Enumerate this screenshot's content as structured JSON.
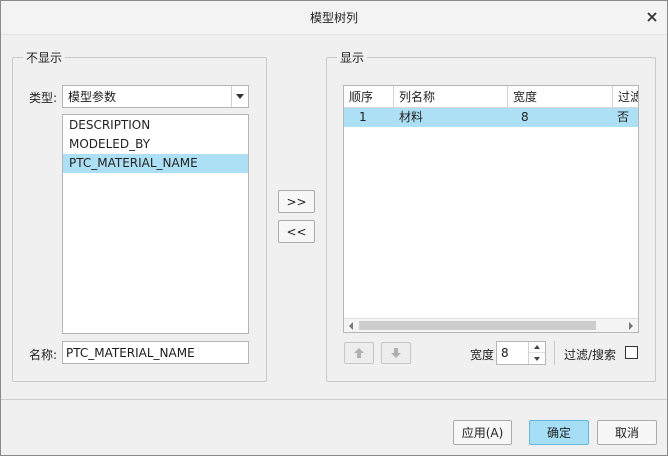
{
  "window": {
    "title": "模型树列"
  },
  "left_panel": {
    "legend": "不显示",
    "type_label": "类型:",
    "type_value": "模型参数",
    "items": [
      {
        "label": "DESCRIPTION"
      },
      {
        "label": "MODELED_BY"
      },
      {
        "label": "PTC_MATERIAL_NAME"
      }
    ],
    "selected_index": 2,
    "name_label": "名称:",
    "name_value": "PTC_MATERIAL_NAME"
  },
  "transfer": {
    "add_label": ">>",
    "remove_label": "<<"
  },
  "right_panel": {
    "legend": "显示",
    "columns": [
      "顺序",
      "列名称",
      "宽度",
      "过滤"
    ],
    "rows": [
      {
        "order": "1",
        "name": "材料",
        "width": "8",
        "filter": "否"
      }
    ],
    "move_up_icon": "arrow-up-icon",
    "move_down_icon": "arrow-down-icon",
    "width_label": "宽度",
    "width_value": "8",
    "filter_search_label": "过滤/搜索"
  },
  "footer": {
    "apply_label": "应用(A)",
    "ok_label": "确定",
    "cancel_label": "取消"
  },
  "colors": {
    "selection": "#aee0f5",
    "primary_button": "#a6def5"
  }
}
